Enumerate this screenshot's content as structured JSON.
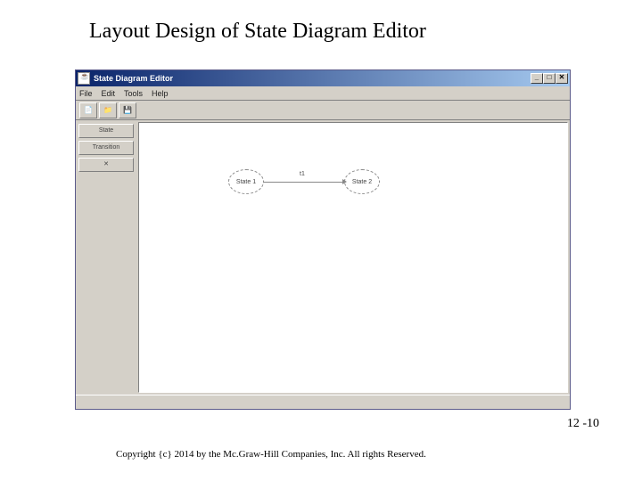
{
  "slide": {
    "title": "Layout Design of State Diagram Editor",
    "page_number": "12 -10",
    "copyright": "Copyright {c} 2014 by the Mc.Graw-Hill Companies, Inc. All rights Reserved."
  },
  "window": {
    "title": "State Diagram Editor",
    "min_label": "_",
    "max_label": "□",
    "close_label": "✕"
  },
  "menu": {
    "items": [
      "File",
      "Edit",
      "Tools",
      "Help"
    ]
  },
  "toolbar": {
    "icons": [
      "📄",
      "📁",
      "💾"
    ]
  },
  "palette": {
    "items": [
      "State",
      "Transition",
      "✕"
    ]
  },
  "canvas": {
    "state1_label": "State 1",
    "state2_label": "State 2",
    "transition_label": "t1"
  }
}
